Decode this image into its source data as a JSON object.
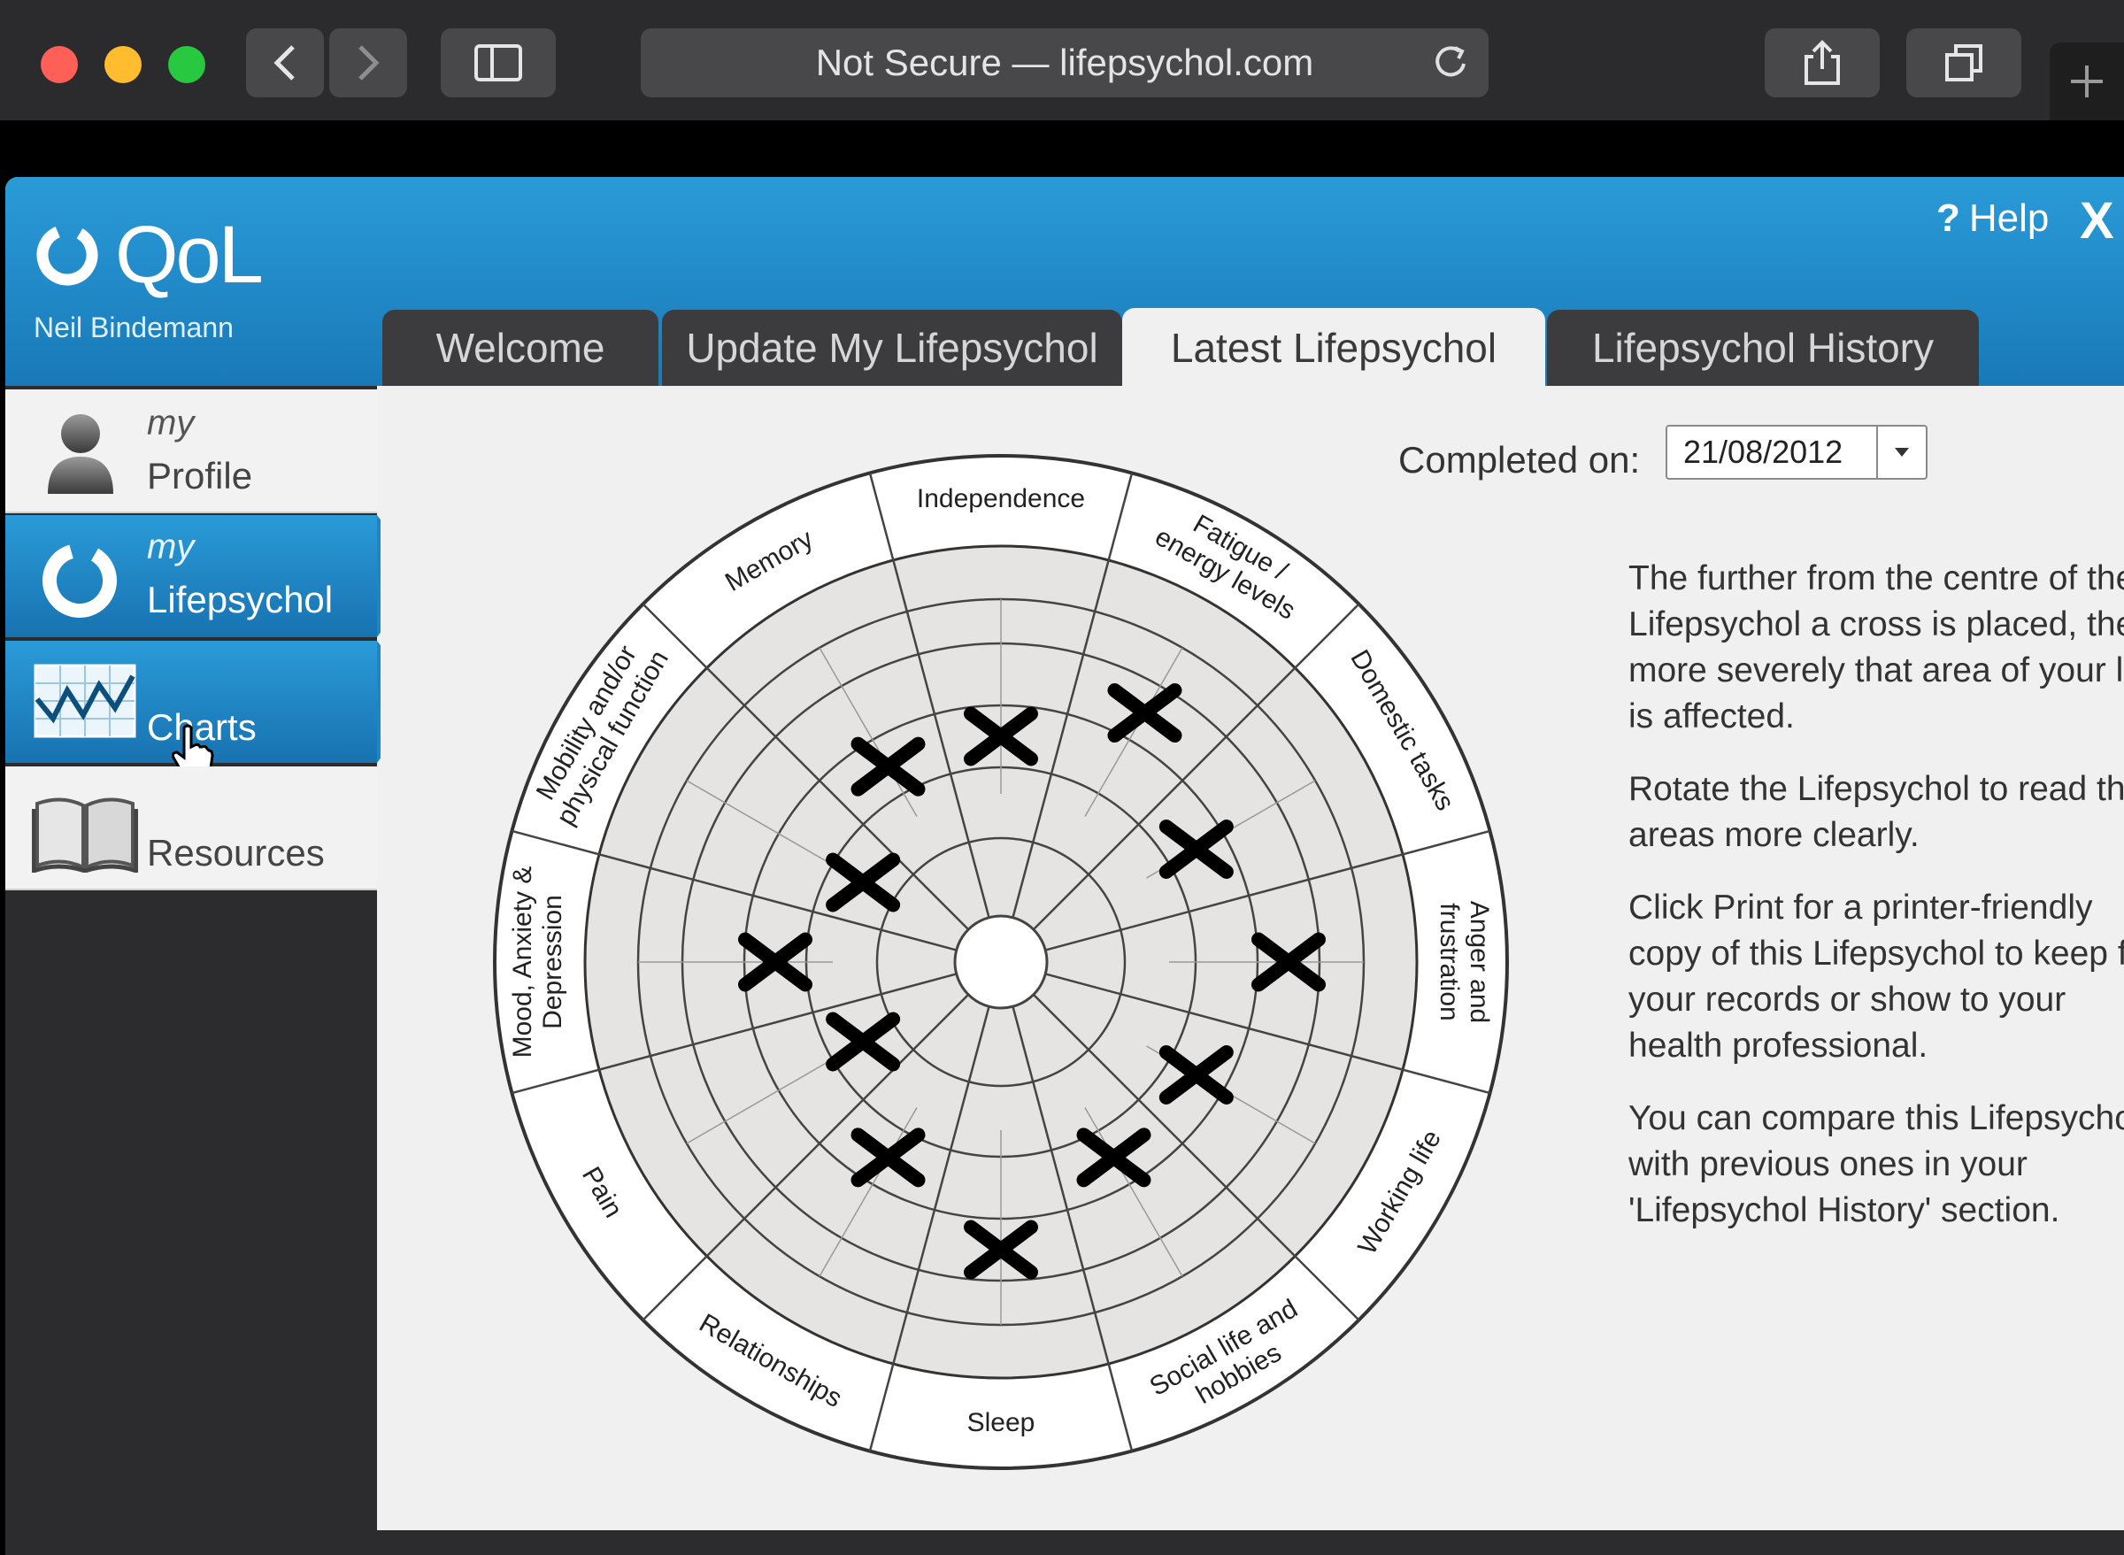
{
  "browser": {
    "address": "Not Secure — lifepsychol.com"
  },
  "app": {
    "logo_text": "QoL",
    "user_name": "Neil Bindemann",
    "help_label": "Help",
    "help_glyph": "?",
    "close_glyph": "X",
    "accent_color": "#1f86c6"
  },
  "tabs": [
    {
      "label": "Welcome",
      "active": false
    },
    {
      "label": "Update My Lifepsychol",
      "active": false
    },
    {
      "label": "Latest Lifepsychol",
      "active": true
    },
    {
      "label": "Lifepsychol History",
      "active": false
    }
  ],
  "sidebar": {
    "items": [
      {
        "prefix": "my",
        "label": "Profile",
        "icon": "person-icon",
        "active": false
      },
      {
        "prefix": "my",
        "label": "Lifepsychol",
        "icon": "ring-icon",
        "active": true
      },
      {
        "prefix": "",
        "label": "Charts",
        "icon": "chart-icon",
        "active": true
      },
      {
        "prefix": "",
        "label": "Resources",
        "icon": "book-icon",
        "active": false
      }
    ]
  },
  "content": {
    "completed_label": "Completed on:",
    "completed_date": "21/08/2012",
    "info": [
      "The further from the centre of the",
      "Lifepsychol a cross is placed, the",
      "more severely that area of your life",
      "is affected.",
      "Rotate the Lifepsychol to read the",
      "areas more clearly.",
      "Click Print for a printer-friendly",
      "copy of this Lifepsychol to keep for",
      "your records or show to your",
      "health professional.",
      "You can compare this Lifepsychol",
      "with previous ones in your",
      "'Lifepsychol History' section."
    ],
    "info_paragraph_breaks": [
      4,
      6,
      10
    ]
  },
  "lifepsychol": {
    "segments": [
      {
        "label": [
          "Independence"
        ],
        "severity": 3
      },
      {
        "label": [
          "Fatigue /",
          "energy levels"
        ],
        "severity": 4
      },
      {
        "label": [
          "Domestic tasks"
        ],
        "severity": 3
      },
      {
        "label": [
          "Anger and",
          "frustration"
        ],
        "severity": 4
      },
      {
        "label": [
          "Working life"
        ],
        "severity": 3
      },
      {
        "label": [
          "Social life and",
          "hobbies"
        ],
        "severity": 3
      },
      {
        "label": [
          "Sleep"
        ],
        "severity": 4
      },
      {
        "label": [
          "Relationships"
        ],
        "severity": 3
      },
      {
        "label": [
          "Pain"
        ],
        "severity": 2
      },
      {
        "label": [
          "Mood, Anxiety &",
          "Depression"
        ],
        "severity": 3
      },
      {
        "label": [
          "Mobility and/or",
          "physical function"
        ],
        "severity": 2
      },
      {
        "label": [
          "Memory"
        ],
        "severity": 3
      }
    ],
    "rings": 5
  }
}
